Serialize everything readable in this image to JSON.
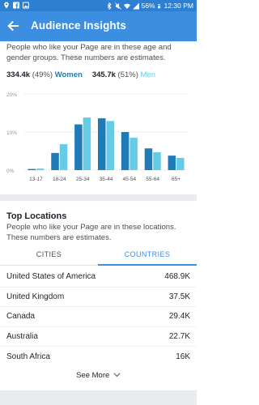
{
  "status_bar": {
    "battery_percent": "56%",
    "time": "12:30 PM"
  },
  "app_bar": {
    "title": "Audience Insights",
    "back_icon": "arrow-left-icon"
  },
  "intro_text": "People who like your Page are in these age and gender groups. These numbers are estimates.",
  "summary": {
    "women_count": "334.4k",
    "women_pct": "(49%)",
    "women_label": "Women",
    "men_count": "345.7k",
    "men_pct": "(51%)",
    "men_label": "Men"
  },
  "colors": {
    "women": "#1f7ab8",
    "men": "#66cbe6",
    "accent": "#3b8ee0"
  },
  "chart_data": {
    "type": "bar",
    "categories": [
      "13-17",
      "18-24",
      "25-34",
      "35-44",
      "45-54",
      "55-64",
      "65+"
    ],
    "series": [
      {
        "name": "Women",
        "values": [
          0.3,
          4.5,
          12.0,
          13.6,
          10.0,
          5.7,
          3.8
        ]
      },
      {
        "name": "Men",
        "values": [
          0.4,
          6.8,
          13.8,
          12.9,
          8.5,
          4.7,
          3.2
        ]
      }
    ],
    "y_ticks": [
      "20%",
      "10%",
      "0%"
    ],
    "ylim": [
      0,
      20
    ],
    "grid": true,
    "title": "",
    "xlabel": "",
    "ylabel": ""
  },
  "top_locations": {
    "title": "Top Locations",
    "description": "People who like your Page are in these locations. These numbers are estimates.",
    "tabs": [
      {
        "label": "CITIES",
        "active": false
      },
      {
        "label": "COUNTRIES",
        "active": true
      }
    ],
    "rows": [
      {
        "name": "United States of America",
        "value": "468.9K"
      },
      {
        "name": "United Kingdom",
        "value": "37.5K"
      },
      {
        "name": "Canada",
        "value": "29.4K"
      },
      {
        "name": "Australia",
        "value": "22.7K"
      },
      {
        "name": "South Africa",
        "value": "16K"
      }
    ],
    "see_more": "See More"
  }
}
